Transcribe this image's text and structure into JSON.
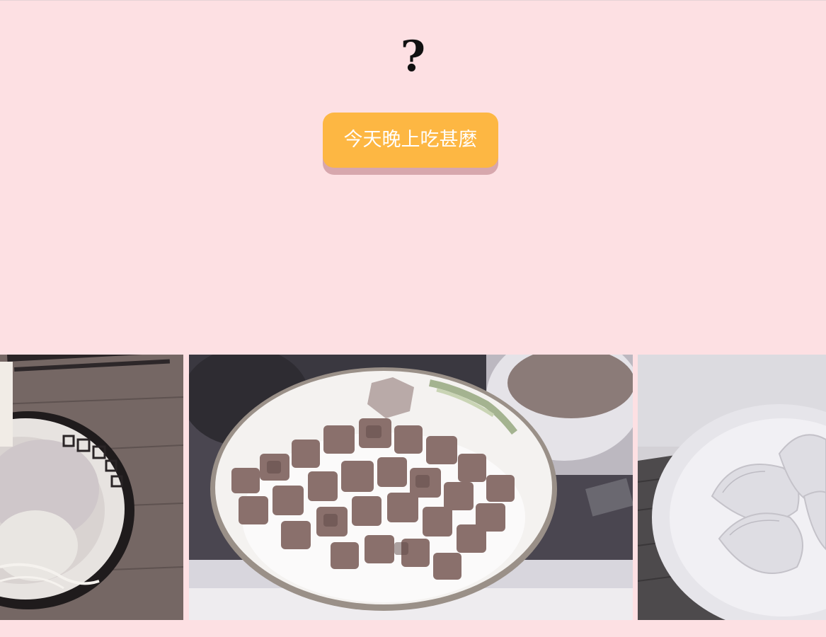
{
  "header": {
    "question_mark": "?"
  },
  "action": {
    "button_label": "今天晚上吃甚麼"
  },
  "gallery": {
    "photos": [
      {
        "icon": "ramen-bowl-photo"
      },
      {
        "icon": "braised-pork-rice-photo"
      },
      {
        "icon": "dumplings-photo"
      }
    ]
  },
  "colors": {
    "background": "#fde0e3",
    "button": "#fdb743",
    "button_shadow": "#d7a7ad",
    "button_text": "#ffffff"
  }
}
